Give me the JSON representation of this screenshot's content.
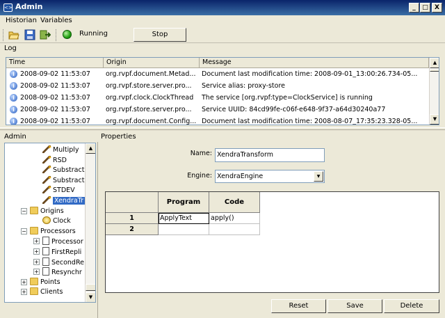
{
  "window": {
    "title": "Admin",
    "app_icon": "<>",
    "controls": {
      "minimize": "_",
      "maximize": "□",
      "close": "X"
    }
  },
  "menu": {
    "items": [
      "Historian",
      "Variables"
    ]
  },
  "toolbar": {
    "status": "Running",
    "stop_label": "Stop",
    "icons": [
      "folder-open-icon",
      "save-icon",
      "export-icon",
      "running-indicator-icon"
    ]
  },
  "log": {
    "label": "Log",
    "columns": [
      "Time",
      "Origin",
      "Message"
    ],
    "rows": [
      {
        "time": "2008-09-02 11:53:07",
        "origin": "org.rvpf.document.Metad...",
        "message": "Document last modification time: 2008-09-01_13:00:26.734-05..."
      },
      {
        "time": "2008-09-02 11:53:07",
        "origin": "org.rvpf.store.server.pro...",
        "message": "Service alias: proxy-store"
      },
      {
        "time": "2008-09-02 11:53:07",
        "origin": "org.rvpf.clock.ClockThread",
        "message": "The service [org.rvpf:type=ClockService] is running"
      },
      {
        "time": "2008-09-02 11:53:07",
        "origin": "org.rvpf.store.server.pro...",
        "message": "Service UUID: 84cd99fe-c06f-e648-9f37-a64d30240a77"
      },
      {
        "time": "2008-09-02 11:53:07",
        "origin": "org.rvpf.document.Config...",
        "message": "Document last modification time: 2008-08-07_17:35:23.328-05..."
      }
    ]
  },
  "admin": {
    "label": "Admin",
    "tree": [
      {
        "label": "Multiply",
        "icon": "wand-icon"
      },
      {
        "label": "RSD",
        "icon": "wand-icon"
      },
      {
        "label": "Substract",
        "icon": "wand-icon"
      },
      {
        "label": "Substract",
        "icon": "wand-icon"
      },
      {
        "label": "STDEV",
        "icon": "wand-icon"
      },
      {
        "label": "XendraTr",
        "icon": "wand-icon",
        "selected": true
      },
      {
        "label": "Origins",
        "icon": "folder-icon",
        "expander": "−"
      },
      {
        "label": "Clock",
        "icon": "clock-icon"
      },
      {
        "label": "Processors",
        "icon": "folder-icon",
        "expander": "−"
      },
      {
        "label": "Processor",
        "icon": "document-icon",
        "expander": "+"
      },
      {
        "label": "FirstRepli",
        "icon": "document-icon",
        "expander": "+"
      },
      {
        "label": "SecondRe",
        "icon": "document-icon",
        "expander": "+"
      },
      {
        "label": "Resynchr",
        "icon": "document-icon",
        "expander": "+"
      },
      {
        "label": "Points",
        "icon": "folder-icon",
        "expander": "+"
      },
      {
        "label": "Clients",
        "icon": "folder-icon",
        "expander": "+"
      }
    ]
  },
  "properties": {
    "label": "Properties",
    "name_label": "Name:",
    "name_value": "XendraTransform",
    "engine_label": "Engine:",
    "engine_value": "XendraEngine",
    "grid": {
      "columns": [
        "Program",
        "Code"
      ],
      "rows": [
        {
          "num": "1",
          "program": "ApplyText",
          "code": "apply()"
        },
        {
          "num": "2",
          "program": "",
          "code": ""
        }
      ]
    },
    "buttons": {
      "reset": "Reset",
      "save": "Save",
      "delete": "Delete"
    }
  },
  "colors": {
    "title_bar": "#0a246a",
    "window_bg": "#ece9d8",
    "selection": "#316ac5",
    "running": "#22a012"
  }
}
